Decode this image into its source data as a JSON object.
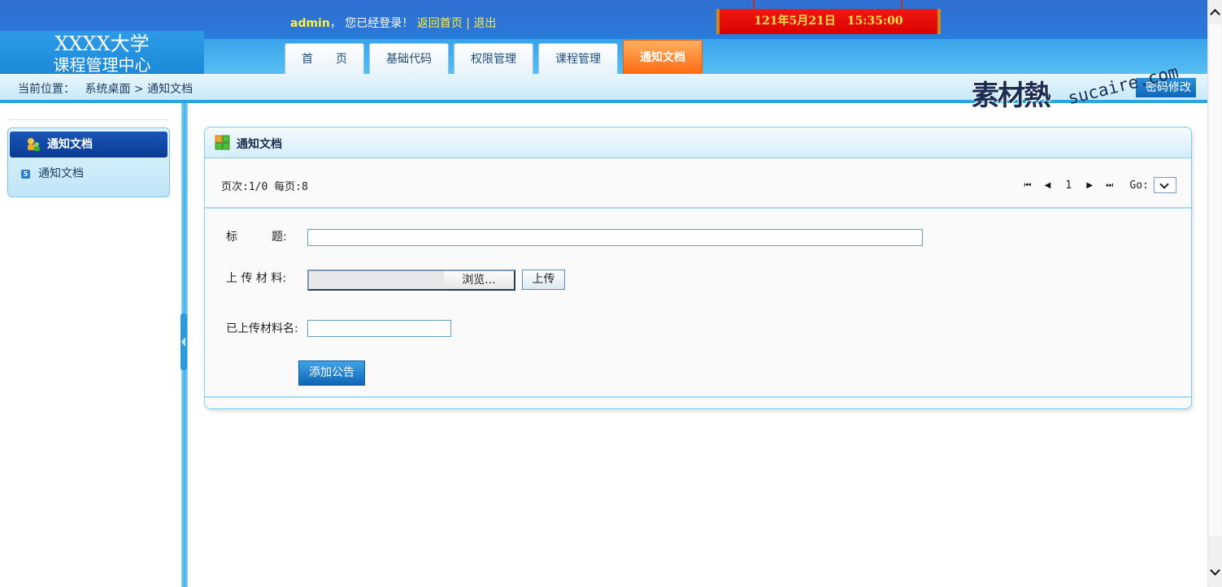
{
  "header": {
    "logo_line1": "XXXX大学",
    "logo_line2": "课程管理中心",
    "username": "admin",
    "welcome_text": "， 您已经登录！",
    "home_link": "返回首页",
    "separator": "|",
    "logout_link": "退出",
    "clock": "121年5月21日　15:35:00"
  },
  "nav": {
    "tabs": [
      {
        "label": "首　　页",
        "active": false
      },
      {
        "label": "基础代码",
        "active": false
      },
      {
        "label": "权限管理",
        "active": false
      },
      {
        "label": "课程管理",
        "active": false
      },
      {
        "label": "通知文档",
        "active": true
      }
    ]
  },
  "breadcrumb": {
    "prefix": "当前位置：",
    "path": "系统桌面 > 通知文档"
  },
  "password_button": "密码修改",
  "watermark": {
    "cn": "素材熱",
    "en": "sucaire.com"
  },
  "sidebar": {
    "header": "通知文档",
    "items": [
      {
        "number": "5",
        "label": "通知文档"
      }
    ]
  },
  "main": {
    "title": "通知文档",
    "pager": {
      "info": "页次:1/0 每页:8",
      "first_icon": "⏮",
      "prev_icon": "◀",
      "current": "1",
      "next_icon": "▶",
      "last_icon": "⏭",
      "go_label": "Go:"
    },
    "form": {
      "title_label": "标　　　题:",
      "title_value": "",
      "upload_label": "上 传 材 料:",
      "browse_button": "浏览...",
      "upload_button": "上传",
      "uploaded_label": "已上传材料名:",
      "uploaded_value": "",
      "submit_button": "添加公告"
    }
  },
  "colors": {
    "header_blue": "#2b77d8",
    "active_tab": "#ff6a12",
    "clock_red": "#e10a05",
    "clock_text": "#ffe24a",
    "accent_cyan": "#29a6e2"
  }
}
